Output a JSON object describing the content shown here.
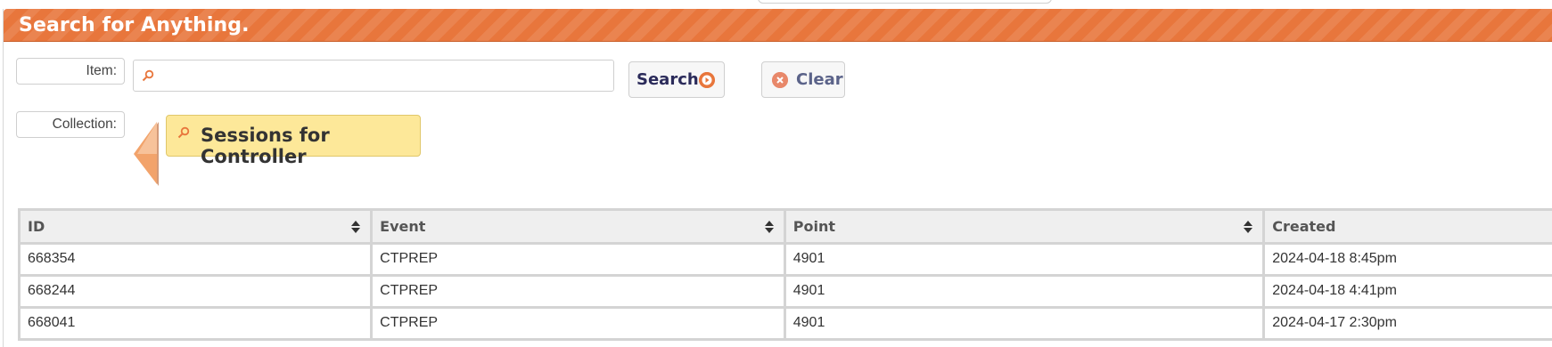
{
  "panel": {
    "title": "Search for Anything."
  },
  "search_form": {
    "item_label": "Item:",
    "item_value": "",
    "search_button_label": "Search",
    "clear_button_label": "Clear",
    "collection_label": "Collection:",
    "collection_value": "Sessions for Controller"
  },
  "icons": {
    "item_input": "search-icon",
    "collection_tag": "search-icon",
    "search_button": "arrow-right-circle-icon",
    "clear_button": "close-circle-icon",
    "collection_pointer": "left-arrow-icon",
    "sort": "sort-icon"
  },
  "colors": {
    "header": "#e8763c",
    "collection_tag": "#fde899",
    "search_text": "#2b2b5a",
    "clear_text": "#5b6389"
  },
  "table": {
    "columns": [
      "ID",
      "Event",
      "Point",
      "Created"
    ],
    "rows": [
      [
        "668354",
        "CTPREP",
        "4901",
        "2024-04-18 8:45pm"
      ],
      [
        "668244",
        "CTPREP",
        "4901",
        "2024-04-18 4:41pm"
      ],
      [
        "668041",
        "CTPREP",
        "4901",
        "2024-04-17 2:30pm"
      ]
    ]
  }
}
